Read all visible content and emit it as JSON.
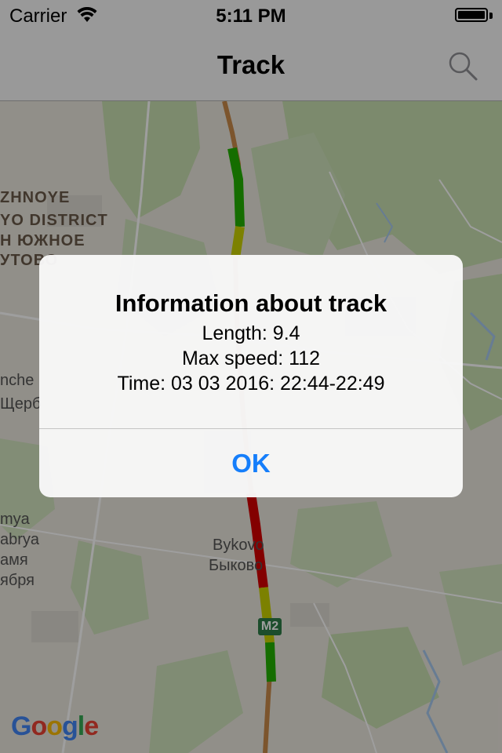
{
  "status_bar": {
    "carrier": "Carrier",
    "time": "5:11 PM"
  },
  "nav_bar": {
    "title": "Track",
    "search_icon": "search-icon"
  },
  "map": {
    "labels": {
      "district_line1": "ZHNOYE",
      "district_line2": "YO DISTRICT",
      "district_ru1": "Н ЮЖНОЕ",
      "district_ru2": "УТОВО",
      "place1": "nche",
      "place2": "Щерб",
      "place3_line1": "mya",
      "place3_line2": "abrya",
      "place3_line3": "амя",
      "place3_line4": "ября",
      "bykovo_en": "Bykovo",
      "bykovo_ru": "Быково",
      "road_badge": "M2"
    },
    "logo": {
      "g1": "G",
      "o1": "o",
      "o2": "o",
      "g2": "g",
      "l": "l",
      "e": "e"
    },
    "track_colors": {
      "green": "#22b000",
      "yellow": "#c9d000",
      "red": "#d40000",
      "road": "#c98a4a"
    }
  },
  "alert": {
    "title": "Information about track",
    "length": "Length: 9.4",
    "max_speed": "Max speed: 112",
    "time": "Time: 03 03 2016: 22:44-22:49",
    "ok_label": "OK"
  }
}
